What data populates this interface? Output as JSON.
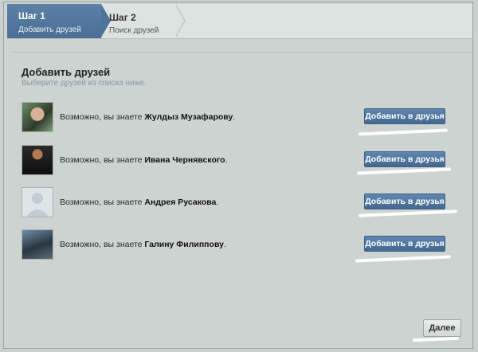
{
  "wizard": {
    "step1": {
      "title": "Шаг 1",
      "subtitle": "Добавить друзей"
    },
    "step2": {
      "title": "Шаг 2",
      "subtitle": "Поиск друзей"
    }
  },
  "heading": "Добавить друзей",
  "subheading": "Выберите друзей из списка ниже.",
  "suggestions": [
    {
      "prefix": "Возможно, вы знаете ",
      "name": "Жулдыз Музафарову",
      "suffix": ".",
      "button": "Добавить в друзья"
    },
    {
      "prefix": "Возможно, вы знаете ",
      "name": "Ивана Чернявского",
      "suffix": ".",
      "button": "Добавить в друзья"
    },
    {
      "prefix": "Возможно, вы знаете ",
      "name": "Андрея Русакова",
      "suffix": ".",
      "button": "Добавить в друзья"
    },
    {
      "prefix": "Возможно, вы знаете ",
      "name": "Галину Филиппову",
      "suffix": ".",
      "button": "Добавить в друзья"
    }
  ],
  "next_button": "Далее"
}
